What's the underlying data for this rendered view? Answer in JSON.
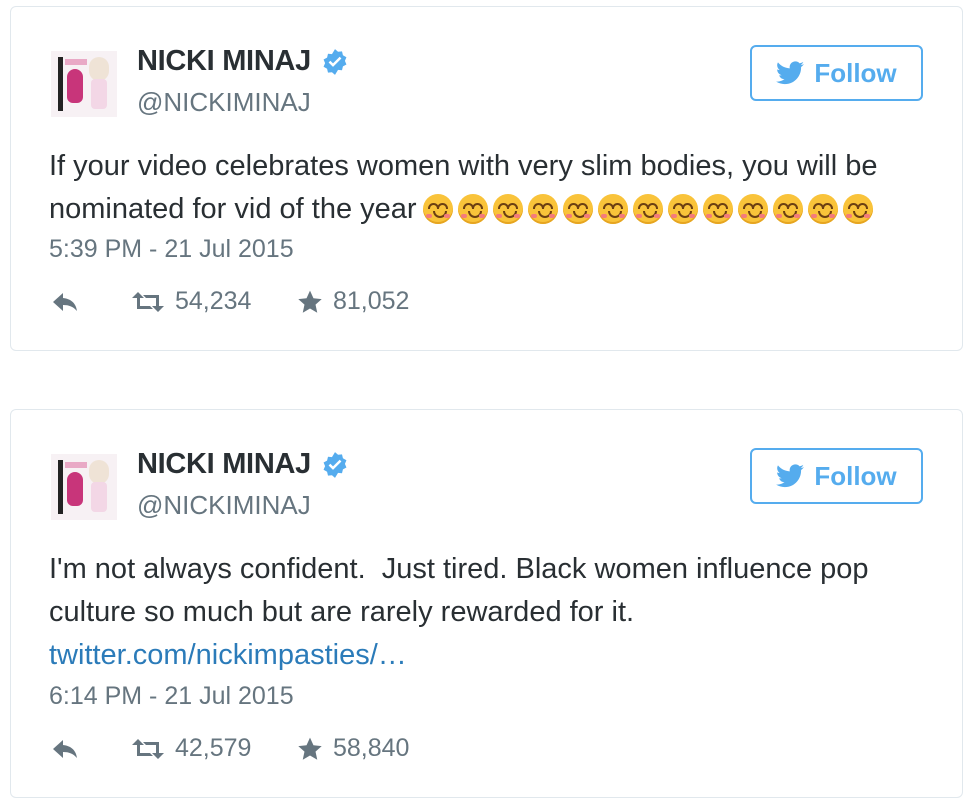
{
  "tweets": [
    {
      "display_name": "NICKI MINAJ",
      "handle": "@NICKIMINAJ",
      "follow_label": "Follow",
      "text": "If your video celebrates women with very slim bodies, you will be nominated for vid of the year",
      "emoji": "smiling-face-with-smiling-eyes",
      "emoji_count": 13,
      "timestamp": "5:39 PM - 21 Jul 2015",
      "retweets": "54,234",
      "favorites": "81,052"
    },
    {
      "display_name": "NICKI MINAJ",
      "handle": "@NICKIMINAJ",
      "follow_label": "Follow",
      "text": "I'm not always confident.  Just tired. Black women influence pop culture so much but are rarely rewarded for it.",
      "link": "twitter.com/nickimpasties/…",
      "timestamp": "6:14 PM - 21 Jul 2015",
      "retweets": "42,579",
      "favorites": "58,840"
    }
  ],
  "colors": {
    "accent": "#55acee",
    "link": "#2b7bb9",
    "text": "#292f33",
    "muted": "#66757f",
    "border": "#e1e8ed"
  }
}
